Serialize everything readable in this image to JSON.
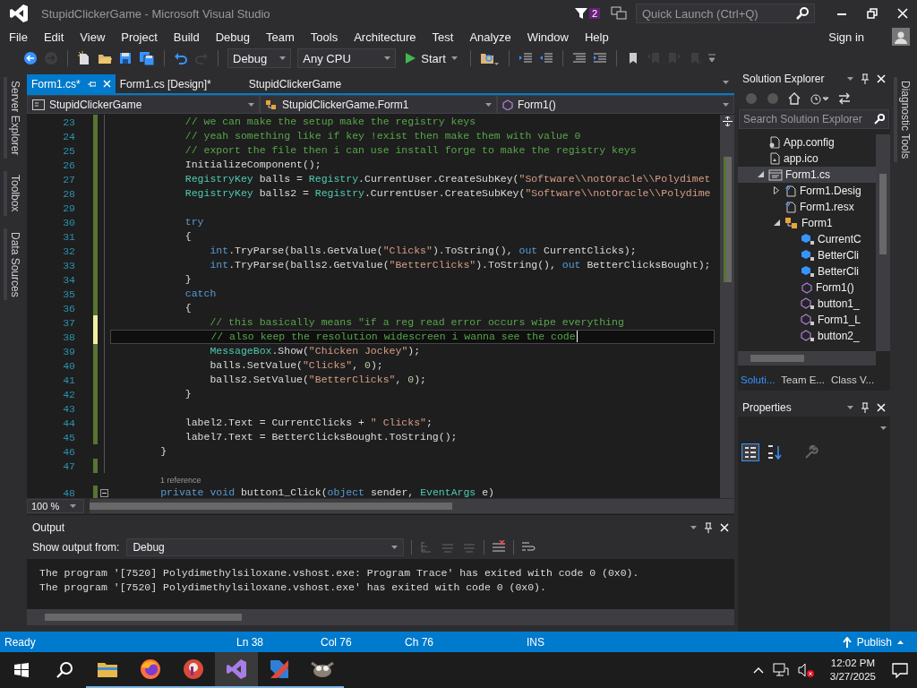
{
  "title": {
    "text": "StupidClickerGame - Microsoft Visual Studio",
    "notifications": "2",
    "quick_launch_placeholder": "Quick Launch (Ctrl+Q)"
  },
  "menu": {
    "items": [
      "File",
      "Edit",
      "View",
      "Project",
      "Build",
      "Debug",
      "Team",
      "Tools",
      "Architecture",
      "Test",
      "Analyze",
      "Window",
      "Help"
    ],
    "sign_in": "Sign in"
  },
  "toolbar": [
    {
      "kind": "back",
      "disabled": false
    },
    {
      "kind": "forward",
      "disabled": true
    },
    {
      "kind": "separator"
    },
    {
      "kind": "new-project",
      "disabled": false
    },
    {
      "kind": "open",
      "disabled": false
    },
    {
      "kind": "save",
      "disabled": false
    },
    {
      "kind": "save-all",
      "disabled": false
    },
    {
      "kind": "separator"
    },
    {
      "kind": "undo",
      "disabled": false
    },
    {
      "kind": "redo",
      "disabled": true
    },
    {
      "kind": "separator"
    },
    {
      "kind": "dropdown",
      "label": "Debug",
      "disabled": false
    },
    {
      "kind": "dropdown",
      "label": "Any CPU",
      "disabled": false
    },
    {
      "kind": "start",
      "label": "Start",
      "disabled": false
    },
    {
      "kind": "separator"
    },
    {
      "kind": "find",
      "disabled": false
    },
    {
      "kind": "separator"
    },
    {
      "kind": "indent",
      "disabled": false
    },
    {
      "kind": "outdent",
      "disabled": false
    },
    {
      "kind": "separator"
    },
    {
      "kind": "comment",
      "disabled": false
    },
    {
      "kind": "uncomment",
      "disabled": false
    },
    {
      "kind": "separator"
    },
    {
      "kind": "bookmark",
      "disabled": false
    },
    {
      "kind": "bookmark-prev",
      "disabled": true
    },
    {
      "kind": "bookmark-next",
      "disabled": true
    },
    {
      "kind": "bookmark-clear",
      "disabled": true
    },
    {
      "kind": "overflow",
      "disabled": false
    }
  ],
  "left_strip": [
    "Server Explorer",
    "Toolbox",
    "Data Sources"
  ],
  "right_strip": [
    "Diagnostic Tools"
  ],
  "editor": {
    "tabs": [
      {
        "label": "Form1.cs*",
        "selected": true
      },
      {
        "label": "Form1.cs [Design]*",
        "selected": false
      },
      {
        "label": "StupidClickerGame",
        "selected": false
      }
    ],
    "nav": [
      {
        "kind": "project",
        "label": "StupidClickerGame"
      },
      {
        "kind": "class",
        "label": "StupidClickerGame.Form1"
      },
      {
        "kind": "method",
        "label": "Form1()"
      }
    ],
    "zoom": "100 %",
    "lines": [
      {
        "number": "23",
        "color": "#577430",
        "current": false,
        "fold": false,
        "tokens": [
          {
            "kind": "comment",
            "text": "            // we can make the setup make the registry keys"
          }
        ]
      },
      {
        "number": "24",
        "color": "#577430",
        "current": false,
        "fold": false,
        "tokens": [
          {
            "kind": "comment",
            "text": "            // yeah something like if key !exist then make them with value 0"
          }
        ]
      },
      {
        "number": "25",
        "color": "#577430",
        "current": false,
        "fold": false,
        "tokens": [
          {
            "kind": "comment",
            "text": "            // export the file then i can use install forge to make the registry keys"
          }
        ]
      },
      {
        "number": "26",
        "color": "#577430",
        "current": false,
        "fold": false,
        "tokens": [
          {
            "kind": "plain",
            "text": "            InitializeComponent();"
          }
        ]
      },
      {
        "number": "27",
        "color": "#577430",
        "current": false,
        "fold": false,
        "tokens": [
          {
            "kind": "type",
            "text": "            RegistryKey"
          },
          {
            "kind": "plain",
            "text": " balls = "
          },
          {
            "kind": "type",
            "text": "Registry"
          },
          {
            "kind": "plain",
            "text": ".CurrentUser.CreateSubKey("
          },
          {
            "kind": "string",
            "text": "\"Software\\\\notOracle\\\\Polydimet"
          }
        ]
      },
      {
        "number": "28",
        "color": "#577430",
        "current": false,
        "fold": false,
        "tokens": [
          {
            "kind": "type",
            "text": "            RegistryKey"
          },
          {
            "kind": "plain",
            "text": " balls2 = "
          },
          {
            "kind": "type",
            "text": "Registry"
          },
          {
            "kind": "plain",
            "text": ".CurrentUser.CreateSubKey("
          },
          {
            "kind": "string",
            "text": "\"Software\\\\notOracle\\\\Polydime"
          }
        ]
      },
      {
        "number": "29",
        "color": "#577430",
        "current": false,
        "fold": false
      },
      {
        "number": "30",
        "color": "#577430",
        "current": false,
        "fold": false,
        "tokens": [
          {
            "kind": "keyword",
            "text": "            try"
          }
        ]
      },
      {
        "number": "31",
        "color": "#577430",
        "current": false,
        "fold": false,
        "tokens": [
          {
            "kind": "plain",
            "text": "            {"
          }
        ]
      },
      {
        "number": "32",
        "color": "#577430",
        "current": false,
        "fold": false,
        "tokens": [
          {
            "kind": "keyword",
            "text": "                int"
          },
          {
            "kind": "plain",
            "text": ".TryParse(balls.GetValue("
          },
          {
            "kind": "string",
            "text": "\"Clicks\""
          },
          {
            "kind": "plain",
            "text": ").ToString(), "
          },
          {
            "kind": "keyword",
            "text": "out"
          },
          {
            "kind": "plain",
            "text": " CurrentClicks);"
          }
        ]
      },
      {
        "number": "33",
        "color": "#577430",
        "current": false,
        "fold": false,
        "tokens": [
          {
            "kind": "keyword",
            "text": "                int"
          },
          {
            "kind": "plain",
            "text": ".TryParse(balls2.GetValue("
          },
          {
            "kind": "string",
            "text": "\"BetterClicks\""
          },
          {
            "kind": "plain",
            "text": ").ToString(), "
          },
          {
            "kind": "keyword",
            "text": "out"
          },
          {
            "kind": "plain",
            "text": " BetterClicksBought);"
          }
        ]
      },
      {
        "number": "34",
        "color": "#577430",
        "current": false,
        "fold": false,
        "tokens": [
          {
            "kind": "plain",
            "text": "            }"
          }
        ]
      },
      {
        "number": "35",
        "color": "#577430",
        "current": false,
        "fold": false,
        "tokens": [
          {
            "kind": "keyword",
            "text": "            catch"
          }
        ]
      },
      {
        "number": "36",
        "color": "#577430",
        "current": false,
        "fold": false,
        "tokens": [
          {
            "kind": "plain",
            "text": "            {"
          }
        ]
      },
      {
        "number": "37",
        "color": "#efefa0",
        "current": false,
        "fold": false,
        "tokens": [
          {
            "kind": "comment",
            "text": "                // this basically means \"if a reg read error occurs wipe everything"
          }
        ]
      },
      {
        "number": "38",
        "color": "#efefa0",
        "current": true,
        "fold": false,
        "tokens": [
          {
            "kind": "comment",
            "text": "                // also keep the resolution widescreen i wanna see the code"
          }
        ]
      },
      {
        "number": "39",
        "color": "#577430",
        "current": false,
        "fold": false,
        "tokens": [
          {
            "kind": "type",
            "text": "                MessageBox"
          },
          {
            "kind": "plain",
            "text": ".Show("
          },
          {
            "kind": "string",
            "text": "\"Chicken Jockey\""
          },
          {
            "kind": "plain",
            "text": ");"
          }
        ]
      },
      {
        "number": "40",
        "color": "#577430",
        "current": false,
        "fold": false,
        "tokens": [
          {
            "kind": "plain",
            "text": "                balls.SetValue("
          },
          {
            "kind": "string",
            "text": "\"Clicks\""
          },
          {
            "kind": "plain",
            "text": ", "
          },
          {
            "kind": "number",
            "text": "0"
          },
          {
            "kind": "plain",
            "text": ");"
          }
        ]
      },
      {
        "number": "41",
        "color": "#577430",
        "current": false,
        "fold": false,
        "tokens": [
          {
            "kind": "plain",
            "text": "                balls2.SetValue("
          },
          {
            "kind": "string",
            "text": "\"BetterClicks\""
          },
          {
            "kind": "plain",
            "text": ", "
          },
          {
            "kind": "number",
            "text": "0"
          },
          {
            "kind": "plain",
            "text": ");"
          }
        ]
      },
      {
        "number": "42",
        "color": "#577430",
        "current": false,
        "fold": false,
        "tokens": [
          {
            "kind": "plain",
            "text": "            }"
          }
        ]
      },
      {
        "number": "43",
        "color": "#577430",
        "current": false,
        "fold": false
      },
      {
        "number": "44",
        "color": "#577430",
        "current": false,
        "fold": false,
        "tokens": [
          {
            "kind": "plain",
            "text": "            label2.Text = CurrentClicks + "
          },
          {
            "kind": "string",
            "text": "\" Clicks\""
          },
          {
            "kind": "plain",
            "text": ";"
          }
        ]
      },
      {
        "number": "45",
        "color": "#577430",
        "current": false,
        "fold": false,
        "tokens": [
          {
            "kind": "plain",
            "text": "            label7.Text = BetterClicksBought.ToString();"
          }
        ]
      },
      {
        "number": "46",
        "current": false,
        "fold": false,
        "tokens": [
          {
            "kind": "plain",
            "text": "        }"
          }
        ]
      },
      {
        "number": "47",
        "color": "#577430",
        "current": false,
        "fold": false
      },
      {
        "number": "48",
        "color": "#577430",
        "current": false,
        "fold": true,
        "codelens": "1 reference",
        "tokens": [
          {
            "kind": "keyword",
            "text": "        private"
          },
          {
            "kind": "keyword",
            "text": " void"
          },
          {
            "kind": "plain",
            "text": " button1_Click("
          },
          {
            "kind": "keyword",
            "text": "object"
          },
          {
            "kind": "plain",
            "text": " sender, "
          },
          {
            "kind": "type",
            "text": "EventArgs"
          },
          {
            "kind": "plain",
            "text": " e)"
          }
        ]
      }
    ]
  },
  "output": {
    "title": "Output",
    "source_label": "Show output from:",
    "source": "Debug",
    "lines": [
      "The program '[7520] Polydimethylsiloxane.vshost.exe: Program Trace' has exited with code 0 (0x0).",
      "The program '[7520] Polydimethylsiloxane.vshost.exe' has exited with code 0 (0x0)."
    ]
  },
  "solution": {
    "title": "Solution Explorer",
    "search_placeholder": "Search Solution Explorer",
    "tree": [
      {
        "label": "App.config",
        "kind": "config",
        "selected": false
      },
      {
        "label": "app.ico",
        "kind": "image",
        "selected": false
      },
      {
        "label": "Form1.cs",
        "kind": "form",
        "selected": true,
        "expanded": true,
        "children": [
          {
            "label": "Form1.Desig",
            "kind": "csfile",
            "selected": false,
            "expanded": false
          },
          {
            "label": "Form1.resx",
            "kind": "csfile",
            "selected": false
          },
          {
            "label": "Form1",
            "kind": "class",
            "selected": false,
            "expanded": true,
            "children": [
              {
                "label": "CurrentC",
                "kind": "field",
                "selected": false
              },
              {
                "label": "BetterCli",
                "kind": "field",
                "selected": false
              },
              {
                "label": "BetterCli",
                "kind": "field",
                "selected": false
              },
              {
                "label": "Form1()",
                "kind": "method",
                "selected": false
              },
              {
                "label": "button1_",
                "kind": "private-method",
                "selected": false
              },
              {
                "label": "Form1_L",
                "kind": "private-method",
                "selected": false
              },
              {
                "label": "button2_",
                "kind": "private-method",
                "selected": false
              }
            ]
          }
        ]
      }
    ],
    "tabs": [
      {
        "label": "Soluti...",
        "selected": true
      },
      {
        "label": "Team E...",
        "selected": false
      },
      {
        "label": "Class V...",
        "selected": false
      }
    ]
  },
  "properties": {
    "title": "Properties"
  },
  "status": {
    "message": "Ready",
    "line": "Ln 38",
    "column": "Col 76",
    "char": "Ch 76",
    "mode": "INS",
    "publish": "Publish"
  },
  "taskbar": {
    "apps": [
      {
        "kind": "files",
        "running": true,
        "active": false
      },
      {
        "kind": "browser",
        "running": true,
        "active": false
      },
      {
        "kind": "paint",
        "running": true,
        "active": false
      },
      {
        "kind": "ide",
        "running": true,
        "active": true
      },
      {
        "kind": "ribbon",
        "running": true,
        "active": false
      },
      {
        "kind": "animal",
        "running": true,
        "active": false
      }
    ],
    "time": "12:02 PM",
    "date": "3/27/2025"
  }
}
